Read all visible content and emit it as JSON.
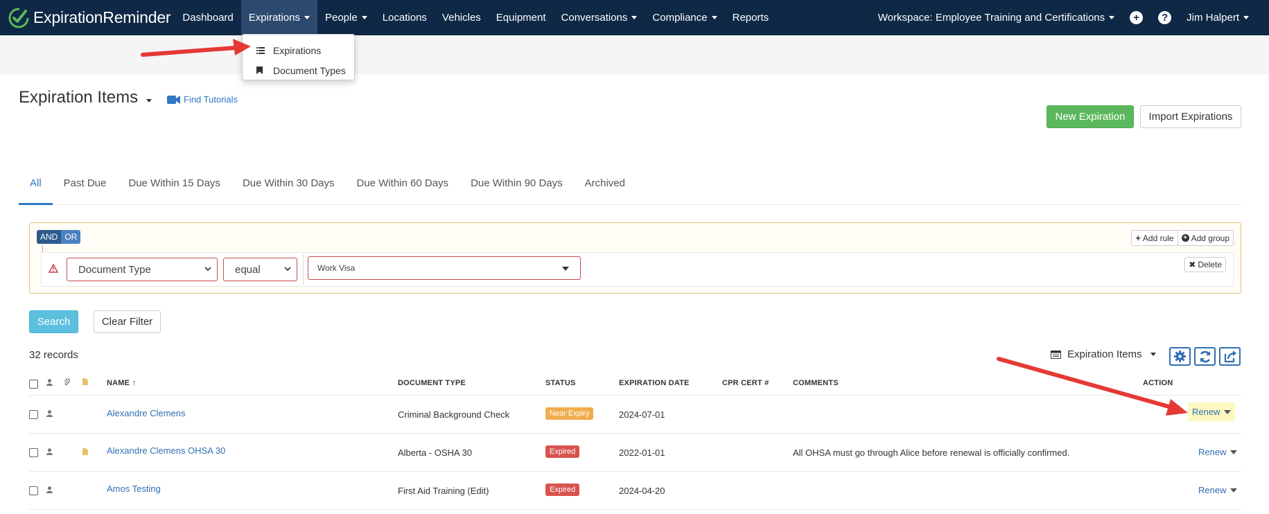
{
  "navbar": {
    "brand_prefix": "Expiration",
    "brand_suffix": "Reminder",
    "items": [
      {
        "label": "Dashboard",
        "dropdown": false
      },
      {
        "label": "Expirations",
        "dropdown": true
      },
      {
        "label": "People",
        "dropdown": true
      },
      {
        "label": "Locations",
        "dropdown": false
      },
      {
        "label": "Vehicles",
        "dropdown": false
      },
      {
        "label": "Equipment",
        "dropdown": false
      },
      {
        "label": "Conversations",
        "dropdown": true
      },
      {
        "label": "Compliance",
        "dropdown": true
      },
      {
        "label": "Reports",
        "dropdown": false
      }
    ],
    "workspace": "Workspace: Employee Training and Certifications",
    "user": "Jim Halpert",
    "colors": {
      "background": "#0f2846",
      "active": "#2c4a6d",
      "logo": "#5cb85c"
    }
  },
  "expirations_menu": {
    "items": [
      {
        "label": "Expirations",
        "icon": "list-icon"
      },
      {
        "label": "Document Types",
        "icon": "bookmark-icon"
      }
    ]
  },
  "page": {
    "title": "Expiration Items",
    "tutorials_link": "Find Tutorials",
    "new_button": "New Expiration",
    "import_button": "Import Expirations"
  },
  "tabs": [
    "All",
    "Past Due",
    "Due Within 15 Days",
    "Due Within 30 Days",
    "Due Within 60 Days",
    "Due Within 90 Days",
    "Archived"
  ],
  "active_tab": "All",
  "filter": {
    "and_label": "AND",
    "or_label": "OR",
    "add_rule": "Add rule",
    "add_group": "Add group",
    "delete": "Delete",
    "field": "Document Type",
    "operator": "equal",
    "value": "Work Visa"
  },
  "actions": {
    "search": "Search",
    "clear_filter": "Clear Filter"
  },
  "records_count": "32 records",
  "view_name": "Expiration Items",
  "table": {
    "columns": {
      "name": "NAME ↑",
      "document_type": "DOCUMENT TYPE",
      "status": "STATUS",
      "expiration_date": "EXPIRATION DATE",
      "cpr_cert": "CPR CERT #",
      "comments": "COMMENTS",
      "action": "ACTION"
    },
    "rows": [
      {
        "name": "Alexandre Clemens",
        "document_type": "Criminal Background Check",
        "status": "Near Expiry",
        "status_color": "#f0ad4e",
        "expiration_date": "2024-07-01",
        "comments": "",
        "action": "Renew",
        "has_document": false
      },
      {
        "name": "Alexandre Clemens OHSA 30",
        "document_type": "Alberta - OSHA 30",
        "status": "Expired",
        "status_color": "#d9534f",
        "expiration_date": "2022-01-01",
        "comments": "All OHSA must go through Alice before renewal is officially confirmed.",
        "action": "Renew",
        "has_document": true
      },
      {
        "name": "Amos Testing",
        "document_type": "First Aid Training (Edit)",
        "status": "Expired",
        "status_color": "#d9534f",
        "expiration_date": "2024-04-20",
        "comments": "",
        "action": "Renew",
        "has_document": false
      }
    ]
  },
  "annotation_color": "#e53935"
}
